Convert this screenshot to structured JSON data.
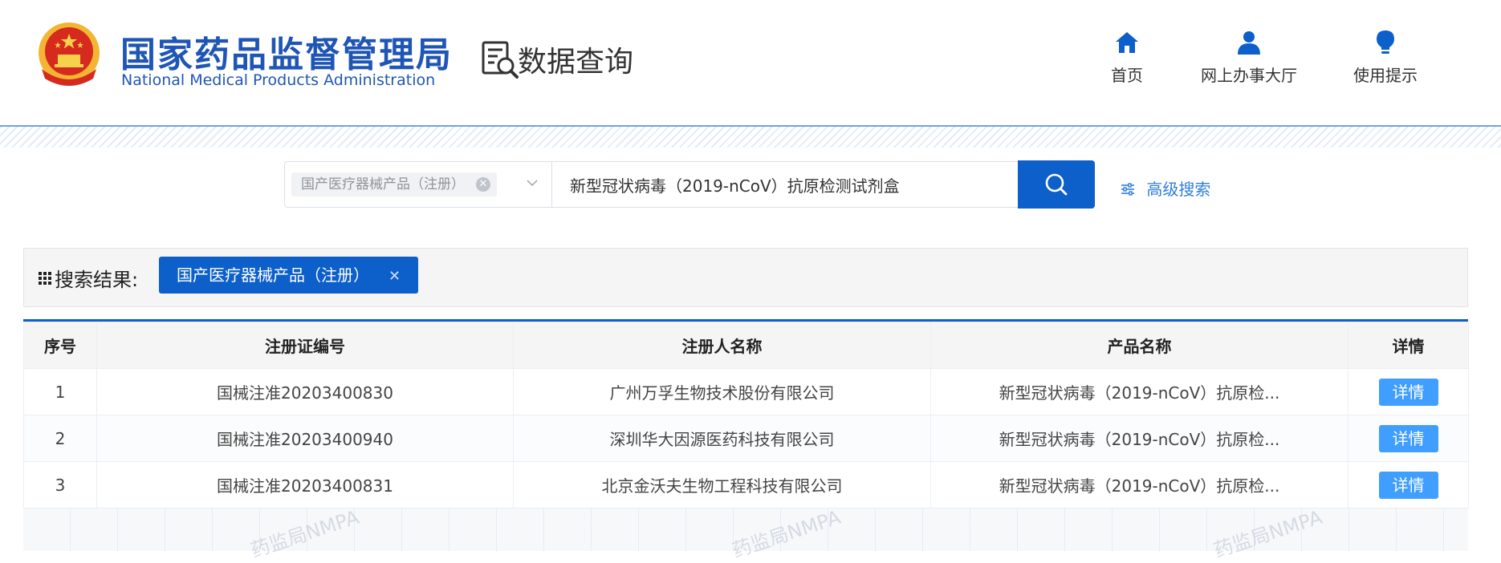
{
  "header": {
    "org_name_cn": "国家药品监督管理局",
    "org_name_en": "National Medical Products Administration",
    "section_title": "数据查询",
    "nav": [
      {
        "label": "首页",
        "icon": "home-icon"
      },
      {
        "label": "网上办事大厅",
        "icon": "user-icon"
      },
      {
        "label": "使用提示",
        "icon": "lightbulb-icon"
      }
    ]
  },
  "search": {
    "category_tag": "国产医疗器械产品（注册）",
    "query": "新型冠状病毒（2019-nCoV）抗原检测试剂盒",
    "advanced_label": "高级搜索"
  },
  "results": {
    "label": "搜索结果:",
    "active_tag": "国产医疗器械产品（注册）",
    "columns": [
      "序号",
      "注册证编号",
      "注册人名称",
      "产品名称",
      "详情"
    ],
    "rows": [
      {
        "index": "1",
        "cert_no": "国械注准20203400830",
        "registrant": "广州万孚生物技术股份有限公司",
        "product": "新型冠状病毒（2019-nCoV）抗原检...",
        "action": "详情"
      },
      {
        "index": "2",
        "cert_no": "国械注准20203400940",
        "registrant": "深圳华大因源医药科技有限公司",
        "product": "新型冠状病毒（2019-nCoV）抗原检...",
        "action": "详情"
      },
      {
        "index": "3",
        "cert_no": "国械注准20203400831",
        "registrant": "北京金沃夫生物工程科技有限公司",
        "product": "新型冠状病毒（2019-nCoV）抗原检...",
        "action": "详情"
      }
    ]
  },
  "watermark_text": "药监局NMPA",
  "colors": {
    "primary": "#0d5fc9",
    "brand_text": "#1f56b5",
    "detail_button": "#409eff",
    "link": "#2f7fd8"
  }
}
